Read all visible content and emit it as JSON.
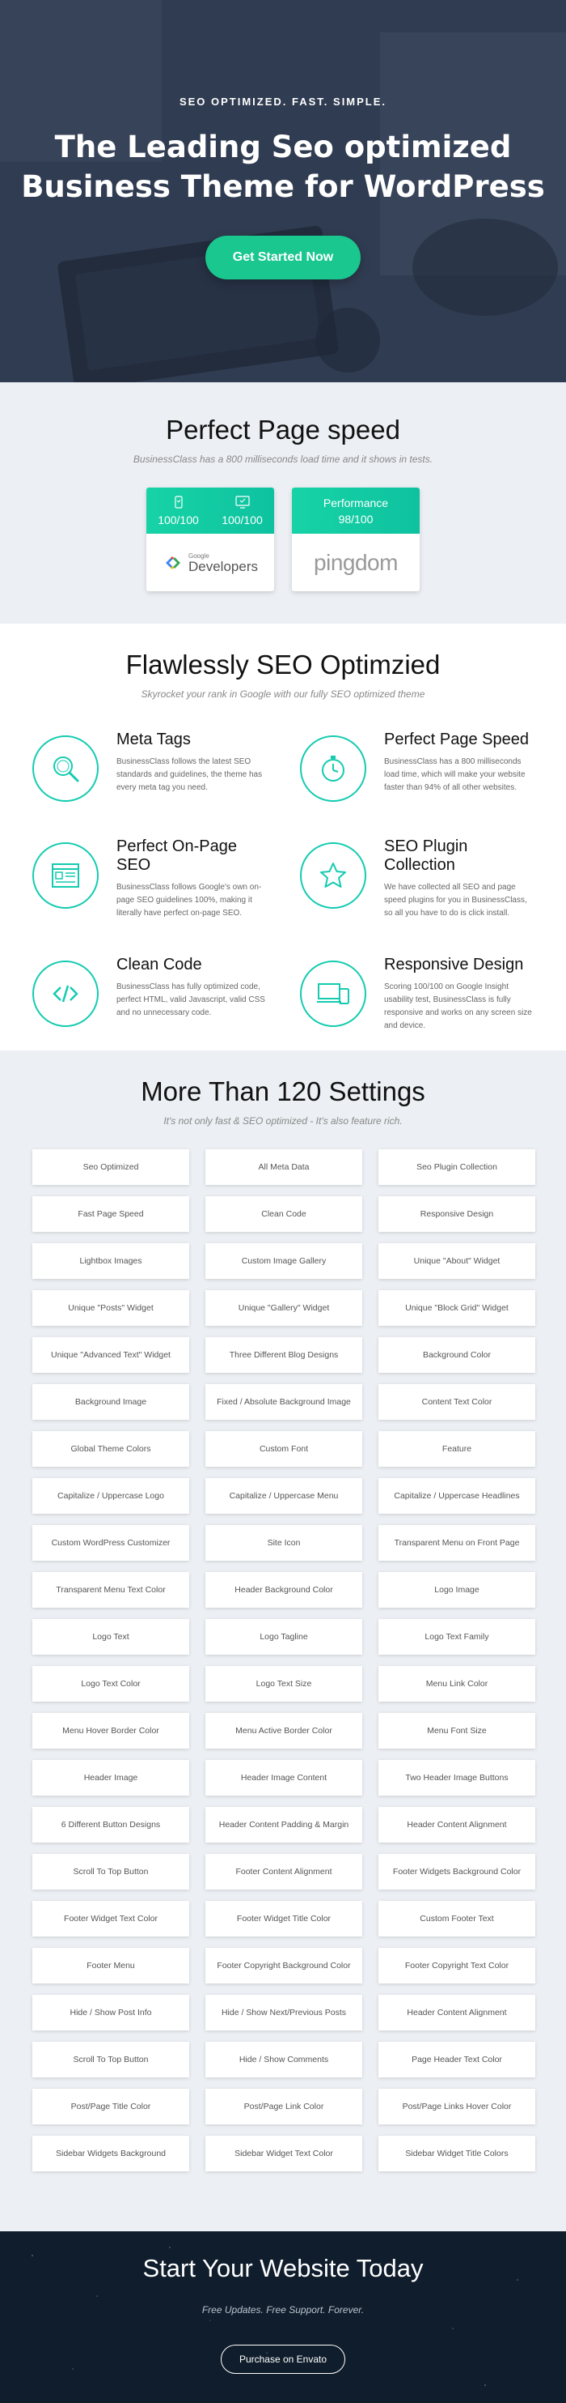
{
  "hero": {
    "eyebrow": "SEO OPTIMIZED. FAST. SIMPLE.",
    "title_line1": "The Leading Seo optimized",
    "title_line2": "Business Theme for WordPress",
    "cta_label": "Get Started Now"
  },
  "speed": {
    "title": "Perfect Page speed",
    "subtitle": "BusinessClass has a 800 milliseconds load time and it shows in tests.",
    "google_card": {
      "mobile_score": "100/100",
      "desktop_score": "100/100",
      "brand_small": "Google",
      "brand_name": "Developers"
    },
    "pingdom_card": {
      "label": "Performance",
      "score": "98/100",
      "brand_name": "pingdom"
    }
  },
  "seo": {
    "title": "Flawlessly SEO Optimzied",
    "subtitle": "Skyrocket your rank in Google with our fully SEO optimized theme",
    "features": [
      {
        "icon": "search-icon",
        "title": "Meta Tags",
        "text": "BusinessClass follows the latest SEO standards and guidelines, the theme has every meta tag you need."
      },
      {
        "icon": "stopwatch-icon",
        "title": "Perfect Page Speed",
        "text": "BusinessClass has a 800 milliseconds load time, which will make your website faster than 94% of all other websites."
      },
      {
        "icon": "webpage-layout-icon",
        "title": "Perfect On-Page SEO",
        "text": "BusinessClass follows Google's own on-page SEO guidelines 100%, making it literally have perfect on-page SEO."
      },
      {
        "icon": "star-icon",
        "title": "SEO Plugin Collection",
        "text": "We have collected all SEO and page speed plugins for you in BusinessClass, so all you have to do is click install."
      },
      {
        "icon": "code-icon",
        "title": "Clean Code",
        "text": "BusinessClass has fully optimized code, perfect HTML, valid Javascript, valid CSS and no unnecessary code."
      },
      {
        "icon": "devices-icon",
        "title": "Responsive Design",
        "text": "Scoring 100/100 on Google Insight usability test, BusinessClass is fully responsive and works on any screen size and device."
      }
    ]
  },
  "settings": {
    "title": "More Than 120 Settings",
    "subtitle": "It's not only fast & SEO optimized - It's also feature rich.",
    "items": [
      "Seo Optimized",
      "All Meta Data",
      "Seo Plugin Collection",
      "Fast Page Speed",
      "Clean Code",
      "Responsive Design",
      "Lightbox Images",
      "Custom Image Gallery",
      "Unique \"About\" Widget",
      "Unique \"Posts\" Widget",
      "Unique \"Gallery\" Widget",
      "Unique \"Block Grid\" Widget",
      "Unique \"Advanced Text\" Widget",
      "Three Different Blog Designs",
      "Background Color",
      "Background Image",
      "Fixed / Absolute Background Image",
      "Content Text Color",
      "Global Theme Colors",
      "Custom Font",
      "Feature",
      "Capitalize / Uppercase Logo",
      "Capitalize / Uppercase Menu",
      "Capitalize / Uppercase Headlines",
      "Custom WordPress Customizer",
      "Site Icon",
      "Transparent Menu on Front Page",
      "Transparent Menu Text Color",
      "Header Background Color",
      "Logo Image",
      "Logo Text",
      "Logo Tagline",
      "Logo Text Family",
      "Logo Text Color",
      "Logo Text Size",
      "Menu Link Color",
      "Menu Hover Border Color",
      "Menu Active Border Color",
      "Menu Font Size",
      "Header Image",
      "Header Image Content",
      "Two Header Image Buttons",
      "6 Different Button Designs",
      "Header Content Padding & Margin",
      "Header Content Alignment",
      "Scroll To Top Button",
      "Footer Content Alignment",
      "Footer Widgets Background Color",
      "Footer Widget Text Color",
      "Footer Widget Title Color",
      "Custom Footer Text",
      "Footer Menu",
      "Footer Copyright Background Color",
      "Footer Copyright Text Color",
      "Hide / Show Post Info",
      "Hide / Show Next/Previous Posts",
      "Header Content Alignment",
      "Scroll To Top Button",
      "Hide / Show Comments",
      "Page Header Text Color",
      "Post/Page Title Color",
      "Post/Page Link Color",
      "Post/Page Links Hover Color",
      "Sidebar Widgets Background",
      "Sidebar Widget Text Color",
      "Sidebar Widget Title Colors"
    ]
  },
  "start": {
    "title": "Start Your Website Today",
    "subtitle": "Free Updates. Free Support. Forever.",
    "button_label": "Purchase on Envato"
  },
  "colors": {
    "accent": "#19c78f",
    "teal": "#14cbb0",
    "section_gray": "#eceff3",
    "footer_navy": "#0f1d2c"
  }
}
